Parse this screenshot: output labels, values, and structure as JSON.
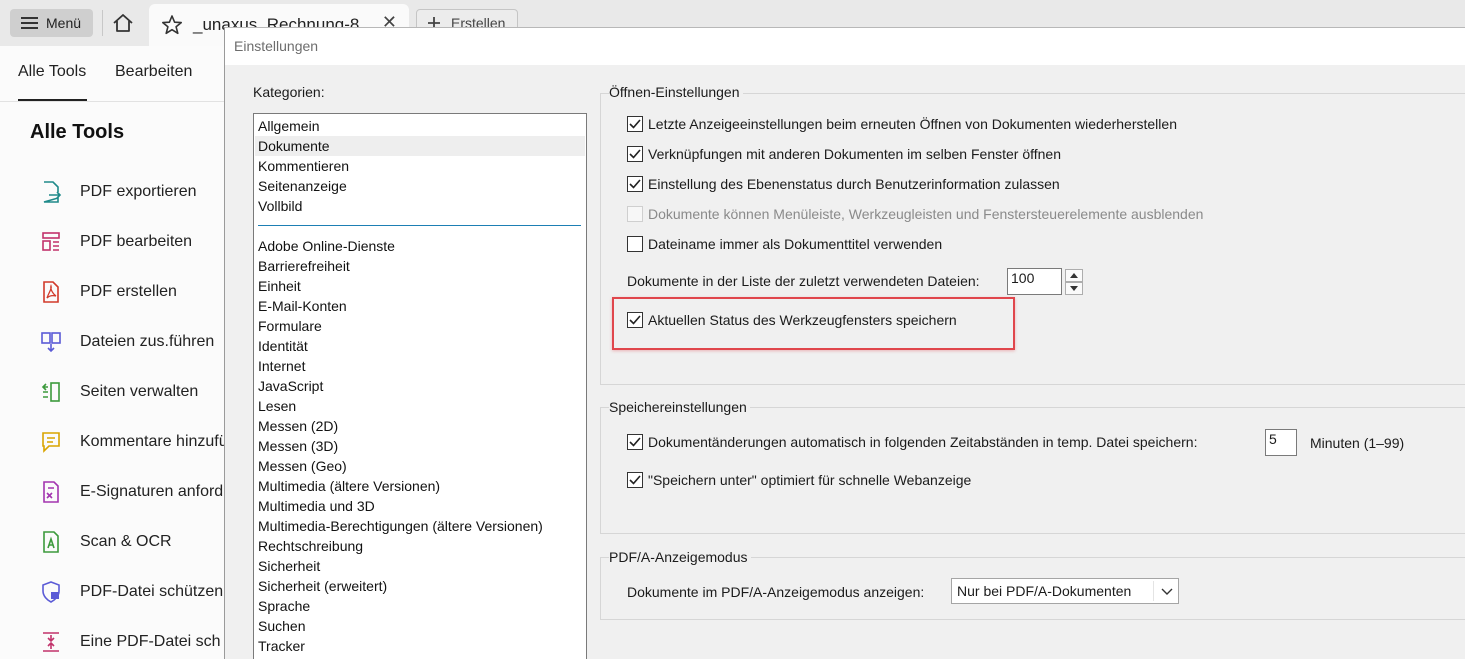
{
  "topbar": {
    "menu_label": "Menü",
    "document_tab": "_unaxus_Rechnung-8",
    "create_label": "Erstellen"
  },
  "left_panel": {
    "tabs": [
      "Alle Tools",
      "Bearbeiten"
    ],
    "title": "Alle Tools",
    "tools": [
      {
        "label": "PDF exportieren",
        "icon": "export-pdf-icon",
        "color": "#1f8a8a"
      },
      {
        "label": "PDF bearbeiten",
        "icon": "edit-pdf-icon",
        "color": "#c2336b"
      },
      {
        "label": "PDF erstellen",
        "icon": "create-pdf-icon",
        "color": "#d13a2b"
      },
      {
        "label": "Dateien zus.führen",
        "icon": "combine-files-icon",
        "color": "#5b5bd6"
      },
      {
        "label": "Seiten verwalten",
        "icon": "organize-pages-icon",
        "color": "#3c9a3c"
      },
      {
        "label": "Kommentare hinzufü",
        "icon": "comment-icon",
        "color": "#d9a400"
      },
      {
        "label": "E-Signaturen anford",
        "icon": "request-esign-icon",
        "color": "#a335b0"
      },
      {
        "label": "Scan & OCR",
        "icon": "scan-ocr-icon",
        "color": "#3c9a3c"
      },
      {
        "label": "PDF-Datei schützen",
        "icon": "protect-pdf-icon",
        "color": "#5b5bd6"
      },
      {
        "label": "Eine PDF-Datei sch",
        "icon": "compress-pdf-icon",
        "color": "#c2336b"
      }
    ]
  },
  "dialog": {
    "title": "Einstellungen",
    "categories_label": "Kategorien:",
    "categories_top": [
      "Allgemein",
      "Dokumente",
      "Kommentieren",
      "Seitenanzeige",
      "Vollbild"
    ],
    "selected_category": "Dokumente",
    "categories_more": [
      "Adobe Online-Dienste",
      "Barrierefreiheit",
      "Einheit",
      "E-Mail-Konten",
      "Formulare",
      "Identität",
      "Internet",
      "JavaScript",
      "Lesen",
      "Messen (2D)",
      "Messen (3D)",
      "Messen (Geo)",
      "Multimedia (ältere Versionen)",
      "Multimedia und 3D",
      "Multimedia-Berechtigungen (ältere Versionen)",
      "Rechtschreibung",
      "Sicherheit",
      "Sicherheit (erweitert)",
      "Sprache",
      "Suchen",
      "Tracker"
    ],
    "open_settings": {
      "title": "Öffnen-Einstellungen",
      "options": [
        {
          "label": "Letzte Anzeigeeinstellungen beim erneuten Öffnen von Dokumenten wiederherstellen",
          "checked": true,
          "enabled": true
        },
        {
          "label": "Verknüpfungen mit anderen Dokumenten im selben Fenster öffnen",
          "checked": true,
          "enabled": true
        },
        {
          "label": "Einstellung des Ebenenstatus durch Benutzerinformation zulassen",
          "checked": true,
          "enabled": true
        },
        {
          "label": "Dokumente können Menüleiste, Werkzeugleisten und Fenstersteuerelemente ausblenden",
          "checked": false,
          "enabled": false
        },
        {
          "label": "Dateiname immer als Dokumenttitel verwenden",
          "checked": false,
          "enabled": true
        }
      ],
      "recent_files_label": "Dokumente in der Liste der zuletzt verwendeten Dateien:",
      "recent_files_value": "100",
      "tool_pane_option": {
        "label": "Aktuellen Status des Werkzeugfensters speichern",
        "checked": true
      }
    },
    "save_settings": {
      "title": "Speichereinstellungen",
      "autosave_label": "Dokumentänderungen automatisch in folgenden Zeitabständen in temp. Datei speichern:",
      "autosave_checked": true,
      "autosave_value": "5",
      "autosave_unit": "Minuten (1–99)",
      "fast_web_label": "\"Speichern unter\" optimiert für schnelle Webanzeige",
      "fast_web_checked": true
    },
    "pdfa": {
      "title": "PDF/A-Anzeigemodus",
      "label": "Dokumente im PDF/A-Anzeigemodus anzeigen:",
      "selected": "Nur bei PDF/A-Dokumenten"
    }
  },
  "colors": {
    "highlight": "#e0464c",
    "list_divider": "#1d7fb4"
  }
}
